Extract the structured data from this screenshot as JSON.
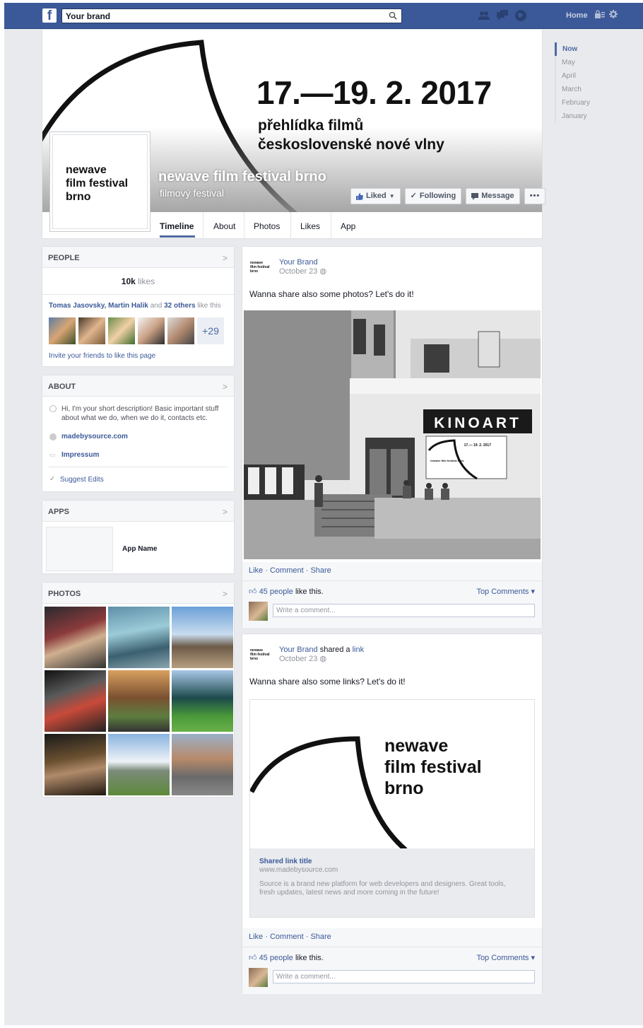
{
  "topbar": {
    "logo": "f",
    "search_value": "Your brand",
    "home_label": "Home",
    "icons": [
      "friend-requests-icon",
      "messages-icon",
      "notifications-icon"
    ]
  },
  "cover": {
    "date": "17.—19. 2. 2017",
    "subtitle_line1": "přehlídka filmů",
    "subtitle_line2": "československé nové vlny",
    "page_name": "newave film festival brno",
    "category": "filmový festival",
    "profile_text_1": "newave",
    "profile_text_2": "film festival",
    "profile_text_3": "brno"
  },
  "actions": {
    "liked": "Liked",
    "following": "Following",
    "message": "Message",
    "more": "•••"
  },
  "tabs": [
    "Timeline",
    "About",
    "Photos",
    "Likes",
    "App"
  ],
  "timeline_nav": [
    "Now",
    "May",
    "April",
    "March",
    "February",
    "January"
  ],
  "people": {
    "title": "PEOPLE",
    "likes_count": "10k",
    "likes_label": "likes",
    "friends": "Tomas Jasovsky, Martin Halik",
    "and": "and",
    "others": "32 others",
    "like_this": "like this",
    "more_count": "+29",
    "invite": "Invite your friends to like this page"
  },
  "about": {
    "title": "ABOUT",
    "description": "Hi, I'm your short description! Basic important stuff about what we do, when we do it, contacts etc.",
    "website": "madebysource.com",
    "impressum": "Impressum",
    "suggest": "Suggest Edits"
  },
  "apps": {
    "title": "APPS",
    "app_name": "App Name"
  },
  "photos": {
    "title": "PHOTOS"
  },
  "post1": {
    "author": "Your Brand",
    "date": "October 23",
    "text": "Wanna share also some photos? Let's do it!",
    "sign_text": "KINOART",
    "poster_date": "17.— 19. 2. 2017",
    "poster_name": "newave film festival brno",
    "like": "Like",
    "comment": "Comment",
    "share": "Share",
    "likes_count": "45 people",
    "likes_suffix": "like this.",
    "top_comments": "Top Comments ▾",
    "write_comment": "Write a comment..."
  },
  "post2": {
    "author": "Your Brand",
    "shared": "shared a",
    "link_word": "link",
    "date": "October 23",
    "text": "Wanna share also some links? Let's do it!",
    "link_logo_1": "newave",
    "link_logo_2": "film festival",
    "link_logo_3": "brno",
    "link_title": "Shared link title",
    "link_url": "www.madebysource.com",
    "link_desc": "Source is a brand new platform for web developers and designers. Great tools, fresh updates, latest news and more coming in the future!",
    "like": "Like",
    "comment": "Comment",
    "share": "Share",
    "likes_count": "45 people",
    "likes_suffix": "like this.",
    "top_comments": "Top Comments ▾",
    "write_comment": "Write a comment..."
  },
  "post_logo": {
    "line1": "newave",
    "line2": "film festival",
    "line3": "brno"
  }
}
